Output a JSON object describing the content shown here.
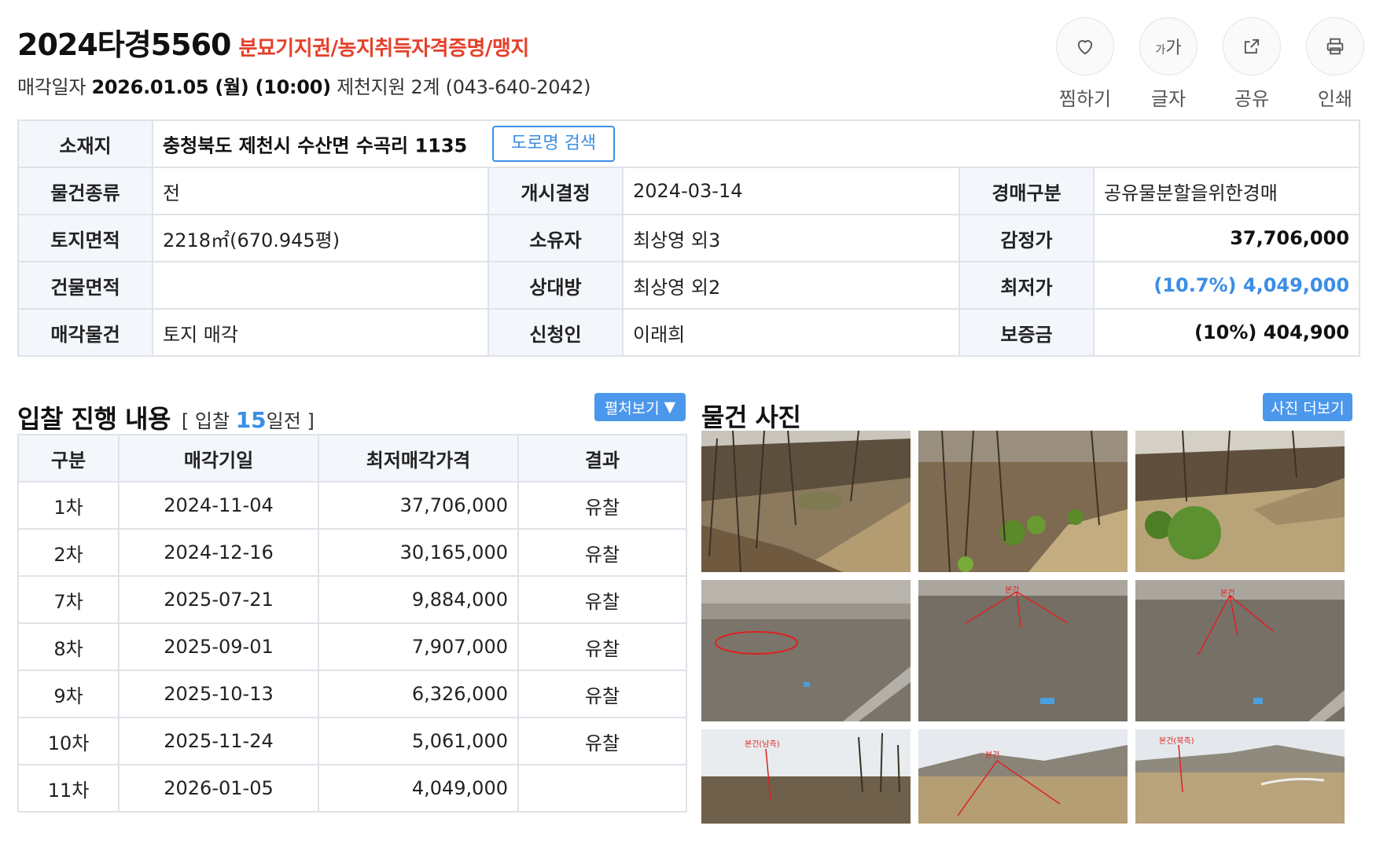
{
  "header": {
    "case_no": "2024타경5560",
    "case_tags": "분묘기지권/농지취득자격증명/맹지",
    "date_prefix": "매각일자",
    "date_value": "2026.01.05 (월) (10:00)",
    "court": "제천지원 2계 (043-640-2042)"
  },
  "actions": [
    {
      "label": "찜하기",
      "icon": "heart-icon"
    },
    {
      "label": "글자",
      "icon": "font-size-icon",
      "glyph_small": "가",
      "glyph_large": "가"
    },
    {
      "label": "공유",
      "icon": "share-icon"
    },
    {
      "label": "인쇄",
      "icon": "print-icon"
    }
  ],
  "info": {
    "location_label": "소재지",
    "location": "충청북도 제천시 수산면 수곡리 1135",
    "road_btn": "도로명 검색",
    "rows": [
      [
        {
          "k": "물건종류",
          "v": "전"
        },
        {
          "k": "개시결정",
          "v": "2024-03-14"
        },
        {
          "k": "경매구분",
          "v": "공유물분할을위한경매"
        }
      ],
      [
        {
          "k": "토지면적",
          "v": "2218㎡(670.945평)"
        },
        {
          "k": "소유자",
          "v": "최상영 외3"
        },
        {
          "k": "감정가",
          "v": "37,706,000"
        }
      ],
      [
        {
          "k": "건물면적",
          "v": ""
        },
        {
          "k": "상대방",
          "v": "최상영 외2"
        },
        {
          "k": "최저가",
          "v": "(10.7%) 4,049,000"
        }
      ],
      [
        {
          "k": "매각물건",
          "v": "토지 매각"
        },
        {
          "k": "신청인",
          "v": "이래희"
        },
        {
          "k": "보증금",
          "v": "(10%) 404,900"
        }
      ]
    ]
  },
  "bid": {
    "title": "입찰 진행 내용",
    "days_prefix": "[ 입찰 ",
    "days_n": "15",
    "days_suffix": "일전 ]",
    "expand_label": "펼처보기",
    "headers": [
      "구분",
      "매각기일",
      "최저매각가격",
      "결과"
    ],
    "rows": [
      {
        "round": "1차",
        "date": "2024-11-04",
        "price": "37,706,000",
        "result": "유찰"
      },
      {
        "round": "2차",
        "date": "2024-12-16",
        "price": "30,165,000",
        "result": "유찰"
      },
      {
        "round": "7차",
        "date": "2025-07-21",
        "price": "9,884,000",
        "result": "유찰"
      },
      {
        "round": "8차",
        "date": "2025-09-01",
        "price": "7,907,000",
        "result": "유찰"
      },
      {
        "round": "9차",
        "date": "2025-10-13",
        "price": "6,326,000",
        "result": "유찰"
      },
      {
        "round": "10차",
        "date": "2025-11-24",
        "price": "5,061,000",
        "result": "유찰"
      },
      {
        "round": "11차",
        "date": "2026-01-05",
        "price": "4,049,000",
        "result": ""
      }
    ]
  },
  "photos": {
    "title": "물건 사진",
    "more_label": "사진 더보기",
    "captions": {
      "south": "본건(남측)",
      "main": "본건",
      "north": "본건(북측)"
    }
  },
  "colors": {
    "accent": "#3b8ee5",
    "tag_red": "#e4412c",
    "button_blue": "#4b97ec"
  }
}
